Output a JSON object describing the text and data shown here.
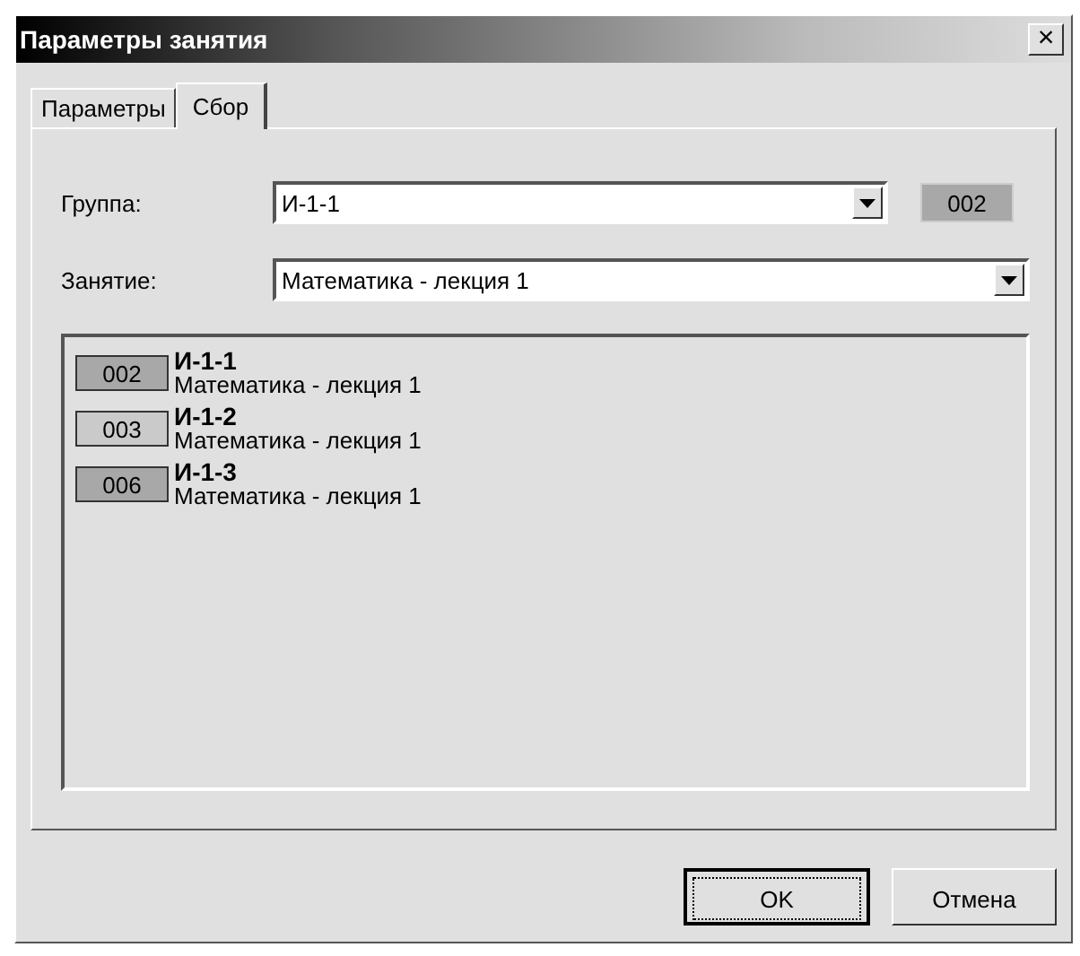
{
  "window": {
    "title": "Параметры занятия",
    "close": "×"
  },
  "tabs": [
    {
      "label": "Параметры",
      "selected": false
    },
    {
      "label": "Сбор",
      "selected": true
    }
  ],
  "group": {
    "label": "Группа:",
    "value": "И-1-1",
    "code": "002",
    "color": "#a8a8a8"
  },
  "lesson": {
    "label": "Занятие:",
    "value": "Математика - лекция 1"
  },
  "list": [
    {
      "code": "002",
      "color": "#a8a8a8",
      "name": "И-1-1",
      "lesson": "Математика - лекция 1"
    },
    {
      "code": "003",
      "color": "#cacaca",
      "name": "И-1-2",
      "lesson": "Математика - лекция 1"
    },
    {
      "code": "006",
      "color": "#a8a8a8",
      "name": "И-1-3",
      "lesson": "Математика - лекция 1"
    }
  ],
  "buttons": [
    {
      "label": "OK",
      "focused": true
    },
    {
      "label": "Отмена",
      "focused": false
    }
  ]
}
